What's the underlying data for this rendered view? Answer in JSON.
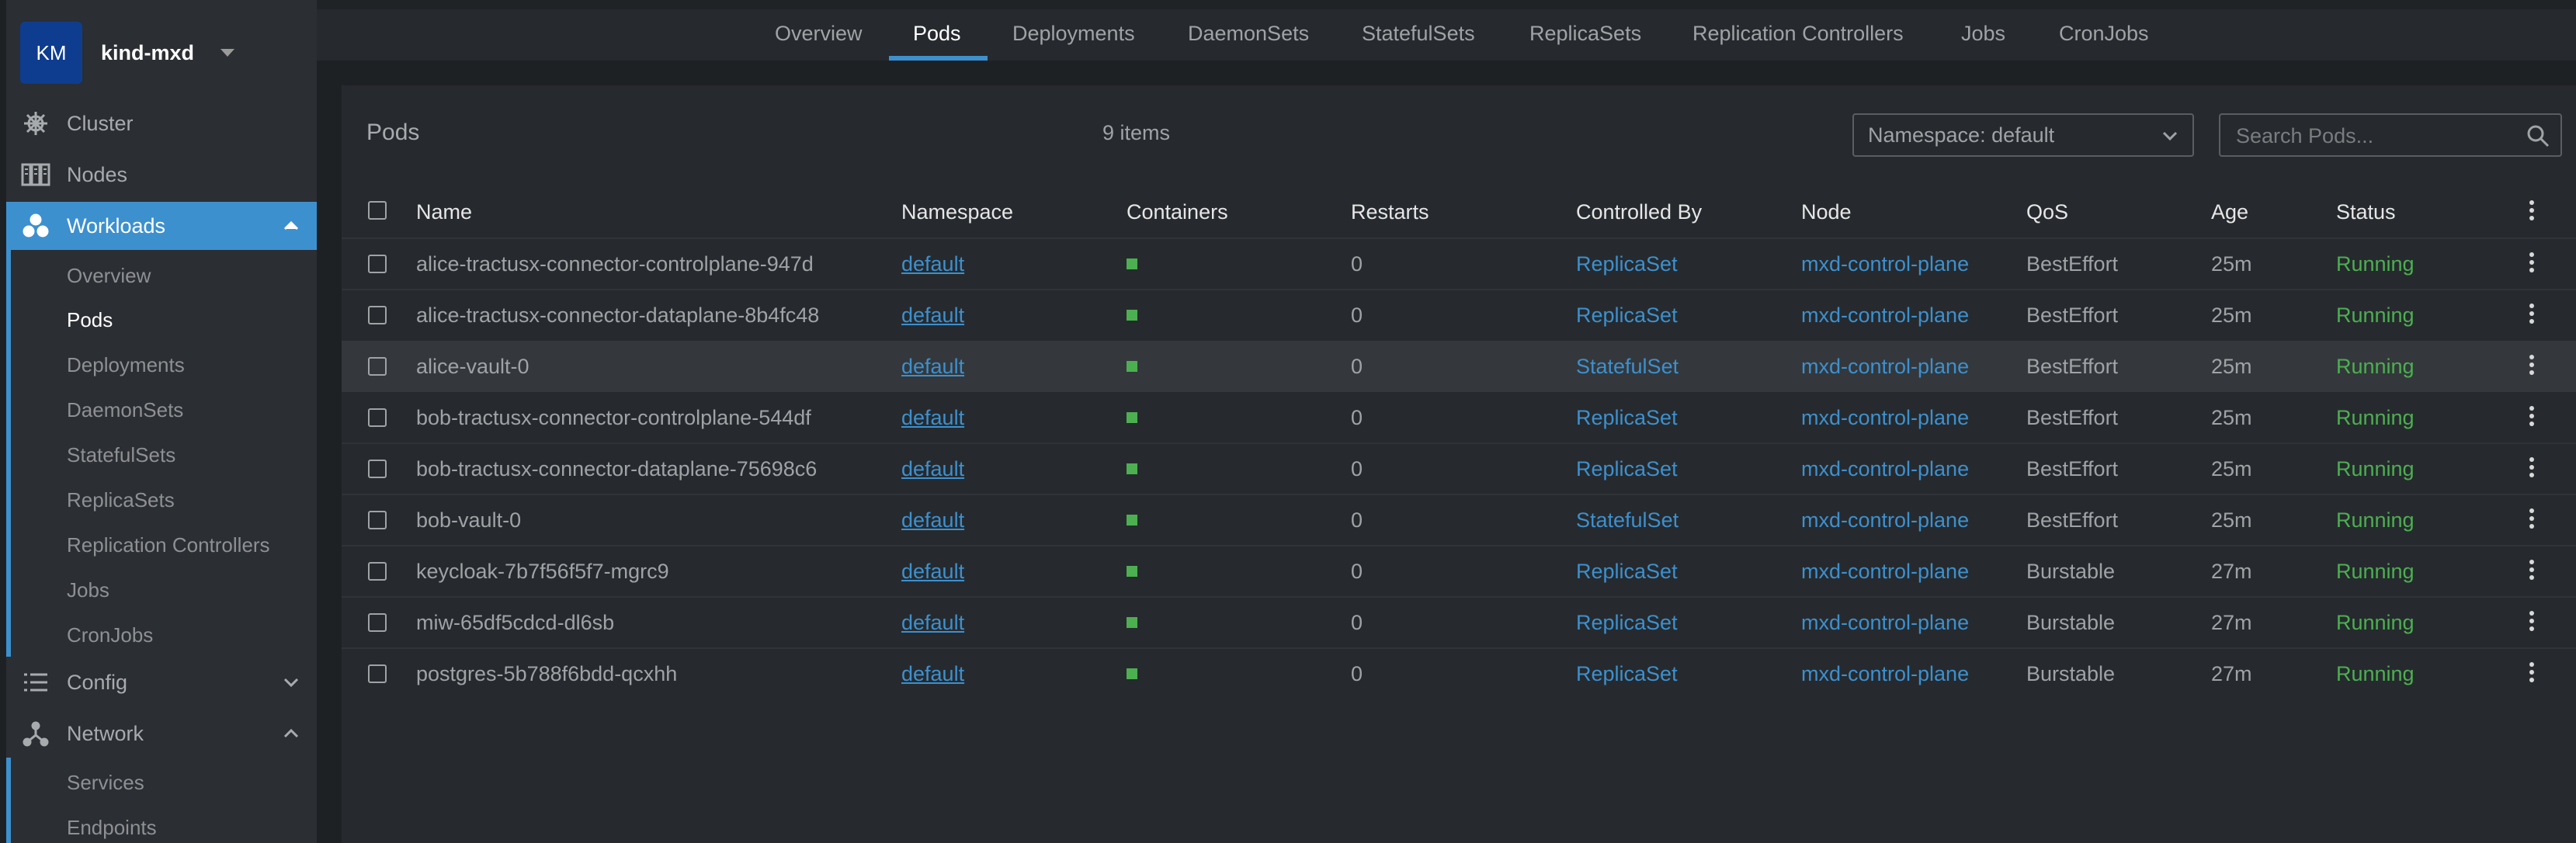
{
  "colors": {
    "accent": "#3d90ce",
    "running": "#4caf50",
    "sidebar_bg": "#2b2e33",
    "content_bg": "#1e2124"
  },
  "cluster": {
    "initials": "KM",
    "name": "kind-mxd"
  },
  "sidebar": {
    "cluster_label": "Cluster",
    "nodes_label": "Nodes",
    "workloads_label": "Workloads",
    "workloads_items": [
      "Overview",
      "Pods",
      "Deployments",
      "DaemonSets",
      "StatefulSets",
      "ReplicaSets",
      "Replication Controllers",
      "Jobs",
      "CronJobs"
    ],
    "config_label": "Config",
    "network_label": "Network",
    "network_items": [
      "Services",
      "Endpoints"
    ]
  },
  "tabs": [
    "Overview",
    "Pods",
    "Deployments",
    "DaemonSets",
    "StatefulSets",
    "ReplicaSets",
    "Replication Controllers",
    "Jobs",
    "CronJobs"
  ],
  "active_tab": "Pods",
  "panel": {
    "title": "Pods",
    "items_count": "9 items",
    "namespace_select": "Namespace: default",
    "search_placeholder": "Search Pods..."
  },
  "table": {
    "columns": [
      "Name",
      "Namespace",
      "Containers",
      "Restarts",
      "Controlled By",
      "Node",
      "QoS",
      "Age",
      "Status"
    ],
    "rows": [
      {
        "name": "alice-tractusx-connector-controlplane-947d",
        "namespace": "default",
        "containers": 1,
        "restarts": "0",
        "controlled_by": "ReplicaSet",
        "node": "mxd-control-plane",
        "qos": "BestEffort",
        "age": "25m",
        "status": "Running"
      },
      {
        "name": "alice-tractusx-connector-dataplane-8b4fc48",
        "namespace": "default",
        "containers": 1,
        "restarts": "0",
        "controlled_by": "ReplicaSet",
        "node": "mxd-control-plane",
        "qos": "BestEffort",
        "age": "25m",
        "status": "Running"
      },
      {
        "name": "alice-vault-0",
        "namespace": "default",
        "containers": 1,
        "restarts": "0",
        "controlled_by": "StatefulSet",
        "node": "mxd-control-plane",
        "qos": "BestEffort",
        "age": "25m",
        "status": "Running"
      },
      {
        "name": "bob-tractusx-connector-controlplane-544df",
        "namespace": "default",
        "containers": 1,
        "restarts": "0",
        "controlled_by": "ReplicaSet",
        "node": "mxd-control-plane",
        "qos": "BestEffort",
        "age": "25m",
        "status": "Running"
      },
      {
        "name": "bob-tractusx-connector-dataplane-75698c6",
        "namespace": "default",
        "containers": 1,
        "restarts": "0",
        "controlled_by": "ReplicaSet",
        "node": "mxd-control-plane",
        "qos": "BestEffort",
        "age": "25m",
        "status": "Running"
      },
      {
        "name": "bob-vault-0",
        "namespace": "default",
        "containers": 1,
        "restarts": "0",
        "controlled_by": "StatefulSet",
        "node": "mxd-control-plane",
        "qos": "BestEffort",
        "age": "25m",
        "status": "Running"
      },
      {
        "name": "keycloak-7b7f56f5f7-mgrc9",
        "namespace": "default",
        "containers": 1,
        "restarts": "0",
        "controlled_by": "ReplicaSet",
        "node": "mxd-control-plane",
        "qos": "Burstable",
        "age": "27m",
        "status": "Running"
      },
      {
        "name": "miw-65df5cdcd-dl6sb",
        "namespace": "default",
        "containers": 1,
        "restarts": "0",
        "controlled_by": "ReplicaSet",
        "node": "mxd-control-plane",
        "qos": "Burstable",
        "age": "27m",
        "status": "Running"
      },
      {
        "name": "postgres-5b788f6bdd-qcxhh",
        "namespace": "default",
        "containers": 1,
        "restarts": "0",
        "controlled_by": "ReplicaSet",
        "node": "mxd-control-plane",
        "qos": "Burstable",
        "age": "27m",
        "status": "Running"
      }
    ]
  }
}
